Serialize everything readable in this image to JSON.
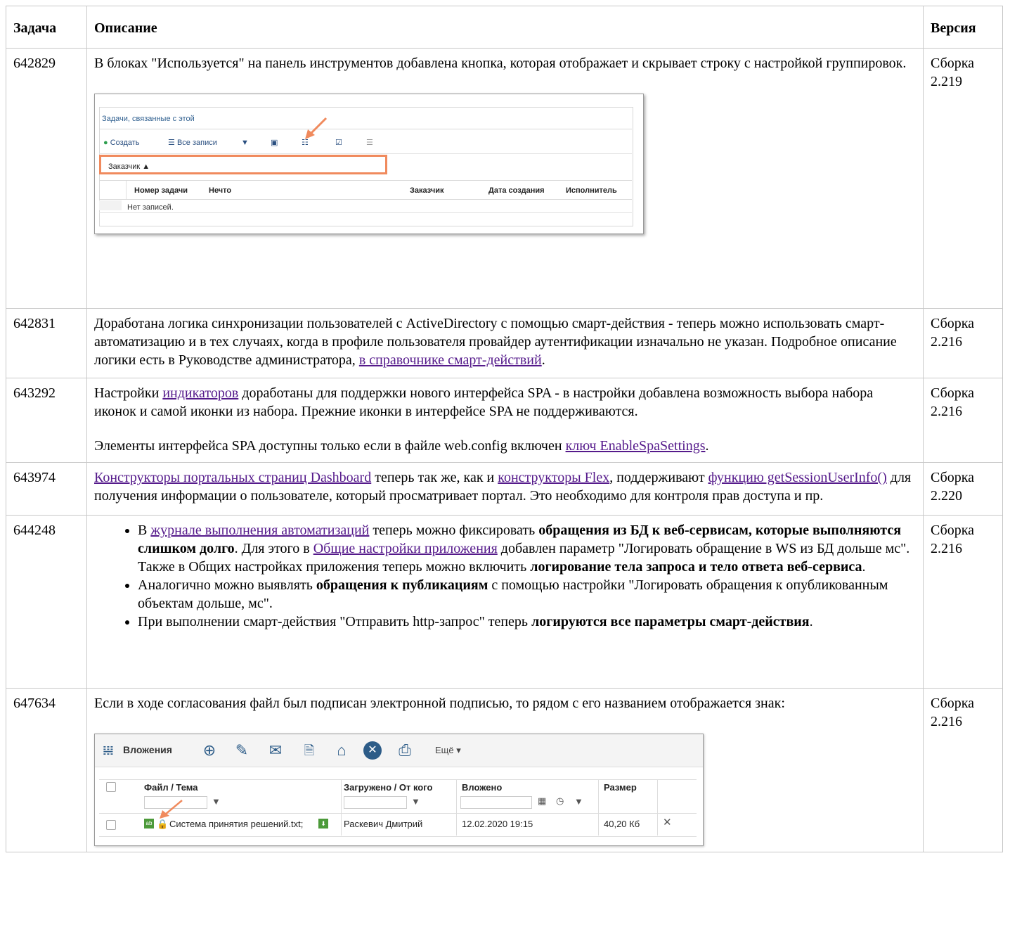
{
  "table": {
    "headers": [
      "Задача",
      "Описание",
      "Версия"
    ],
    "rows": [
      {
        "task": "642829",
        "version": [
          "Сборка",
          "2.219"
        ],
        "text": "В блоках \"Используется\" на панель инструментов добавлена кнопка, которая отображает и скрывает строку с настройкой группировок."
      },
      {
        "task": "642831",
        "version": [
          "Сборка",
          "2.216"
        ],
        "text_before": "Доработана логика синхронизации пользователей с ActiveDirectory с помощью смарт-действия - теперь можно использовать смарт-автоматизацию и в тех случаях, когда в профиле пользователя провайдер аутентификации изначально не указан. Подробное описание логики есть в Руководстве администратора, ",
        "link": "в справочнике смарт-действий",
        "text_after": "."
      },
      {
        "task": "643292",
        "version": [
          "Сборка",
          "2.216"
        ],
        "p1_before": "Настройки ",
        "p1_link": "индикаторов",
        "p1_after": " доработаны для поддержки нового интерфейса SPA - в настройки добавлена возможность выбора набора иконок и самой иконки из набора. Прежние иконки в интерфейсе SPA не поддерживаются.",
        "p2_before": "Элементы интерфейса SPA доступны только если в файле web.config включен ",
        "p2_link": "ключ EnableSpaSettings",
        "p2_after": "."
      },
      {
        "task": "643974",
        "version": [
          "Сборка",
          "2.220"
        ],
        "link1": "Конструкторы портальных страниц Dashboard",
        "mid1": " теперь так же, как и ",
        "link2": "конструкторы Flex",
        "mid2": ", поддерживают ",
        "link3": "функцию getSessionUserInfo()",
        "after": " для получения информации о пользователе, который просматривает портал. Это необходимо для контроля прав доступа и пр."
      },
      {
        "task": "644248",
        "version": [
          "Сборка",
          "2.216"
        ],
        "b1_t1": "В ",
        "b1_link1": "журнале выполнения автоматизаций",
        "b1_t2": " теперь можно фиксировать ",
        "b1_bold1": "обращения из БД к веб-сервисам, которые выполняются слишком долго",
        "b1_t3": ". Для этого в ",
        "b1_link2": "Общие настройки приложения",
        "b1_t4": " добавлен параметр \"Логировать обращение в WS из БД дольше мс\". Также в Общих настройках приложения теперь можно включить ",
        "b1_bold2": "логирование тела запроса и тело ответа веб-сервиса",
        "b1_t5": ".",
        "b2_t1": "Аналогично можно выявлять ",
        "b2_bold": "обращения к публикациям",
        "b2_t2": " с помощью настройки \"Логировать обращения к опубликованным объектам дольше, мс\".",
        "b3_t1": "При выполнении смарт-действия \"Отправить http-запрос\" теперь ",
        "b3_bold": "логируются все параметры смарт-действия",
        "b3_t2": "."
      },
      {
        "task": "647634",
        "version": [
          "Сборка",
          "2.216"
        ],
        "text": "Если в ходе согласования файл был подписан электронной подписью, то рядом с его названием отображается знак:"
      }
    ]
  },
  "shot1": {
    "tab": "Задачи, связанные с этой",
    "create": "Создать",
    "all_records": "Все записи",
    "group_field": "Заказчик ▲",
    "columns": [
      "Номер задачи",
      "Нечто",
      "Заказчик",
      "Дата создания",
      "Исполнитель"
    ],
    "empty": "Нет записей.",
    "accent": "#f08a5d"
  },
  "shot2": {
    "title": "Вложения",
    "more": "Ещё ▾",
    "columns": [
      "Файл / Тема",
      "Загружено / От кого",
      "Вложено",
      "Размер"
    ],
    "file": "Система принятия решений.txt;",
    "uploader": "Раскевич Дмитрий",
    "date": "12.02.2020 19:15",
    "size": "40,20 Кб",
    "accent": "#f08a5d"
  }
}
